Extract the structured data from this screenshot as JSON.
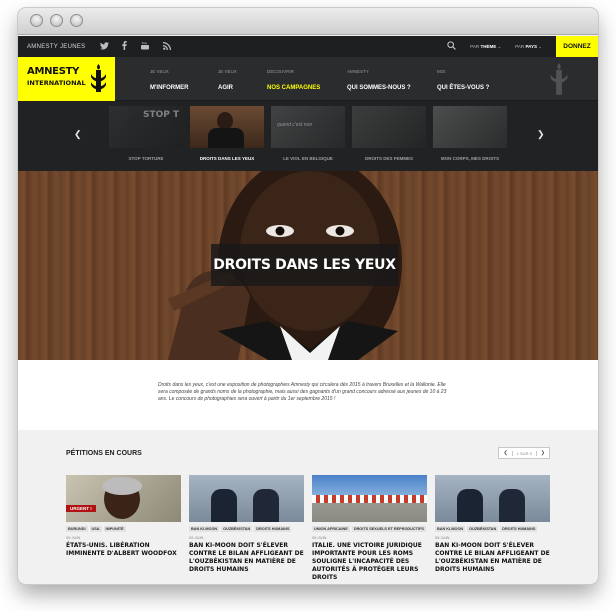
{
  "topbar": {
    "brand": "AMNESTY JEUNES",
    "social": [
      "twitter-icon",
      "facebook-icon",
      "youtube-icon",
      "rss-icon"
    ],
    "theme_prefix": "PAR",
    "theme_label": "THÈME",
    "country_prefix": "PAR",
    "country_label": "PAYS",
    "donate": "DONNEZ"
  },
  "logo": {
    "line1": "AMNESTY",
    "line2": "INTERNATIONAL"
  },
  "nav": [
    {
      "small": "JE VEUX",
      "label": "M'INFORMER"
    },
    {
      "small": "JE VEUX",
      "label": "AGIR"
    },
    {
      "small": "DÉCOUVRIR",
      "label": "NOS CAMPAGNES"
    },
    {
      "small": "AMNESTY",
      "label": "QUI SOMMES-NOUS ?"
    },
    {
      "small": "MOI",
      "label": "QUI ÊTES-VOUS ?"
    }
  ],
  "carousel": {
    "items": [
      {
        "label": "STOP TORTURE",
        "caption": "STOP T"
      },
      {
        "label": "DROITS DANS LES YEUX"
      },
      {
        "label": "LE VIOL EN BELGIQUE",
        "caption": "quand c'est non"
      },
      {
        "label": "DROITS DES FEMMES"
      },
      {
        "label": "MON CORPS, MES DROITS"
      }
    ]
  },
  "hero": {
    "title": "DROITS DANS LES YEUX"
  },
  "intro": {
    "text": "Droits dans les yeux, c'est une exposition de photographies Amnesty qui circulera dès 2015 à travers Bruxelles et la Wallonie. Elle sera composée de grands noms de la photographie, mais aussi des gagnants d'un grand concours adressé aux jeunes de 10 à 23 ans. Le concours de photographies sera ouvert à partir du 1er septembre 2015 !"
  },
  "petitions": {
    "title": "PÉTITIONS EN COURS",
    "pager": "1 SUR 3",
    "cards": [
      {
        "tags": [
          "BURUNDI",
          "USA",
          "IMPUNITÉ"
        ],
        "date": "05 JUIN",
        "title": "ÉTATS-UNIS. LIBÉRATION IMMINENTE D'ALBERT WOODFOX",
        "badge": "URGENT !"
      },
      {
        "tags": [
          "BAN KI-MOON",
          "OUZBÉKISTAN",
          "DROITS HUMAINS"
        ],
        "date": "05 JUIN",
        "title": "BAN KI-MOON DOIT S'ÉLEVER CONTRE LE BILAN AFFLIGEANT DE L'OUZBÉKISTAN EN MATIÈRE DE DROITS HUMAINS"
      },
      {
        "tags": [
          "UNION AFRICAINE",
          "DROITS SEXUELS ET REPRODUCTIFS"
        ],
        "date": "05 JUIN",
        "title": "ITALIE. UNE VICTOIRE JURIDIQUE IMPORTANTE POUR LES ROMS SOULIGNE L'INCAPACITÉ DES AUTORITÉS À PROTÉGER LEURS DROITS"
      },
      {
        "tags": [
          "BAN KI-MOON",
          "OUZBÉKISTAN",
          "DROITS HUMAINS"
        ],
        "date": "05 JUIN",
        "title": "BAN KI-MOON DOIT S'ÉLEVER CONTRE LE BILAN AFFLIGEANT DE L'OUZBÉKISTAN EN MATIÈRE DE DROITS HUMAINS"
      }
    ]
  },
  "colors": {
    "accent": "#ffff00",
    "dark": "#1d1f21",
    "urgent": "#b11212"
  }
}
